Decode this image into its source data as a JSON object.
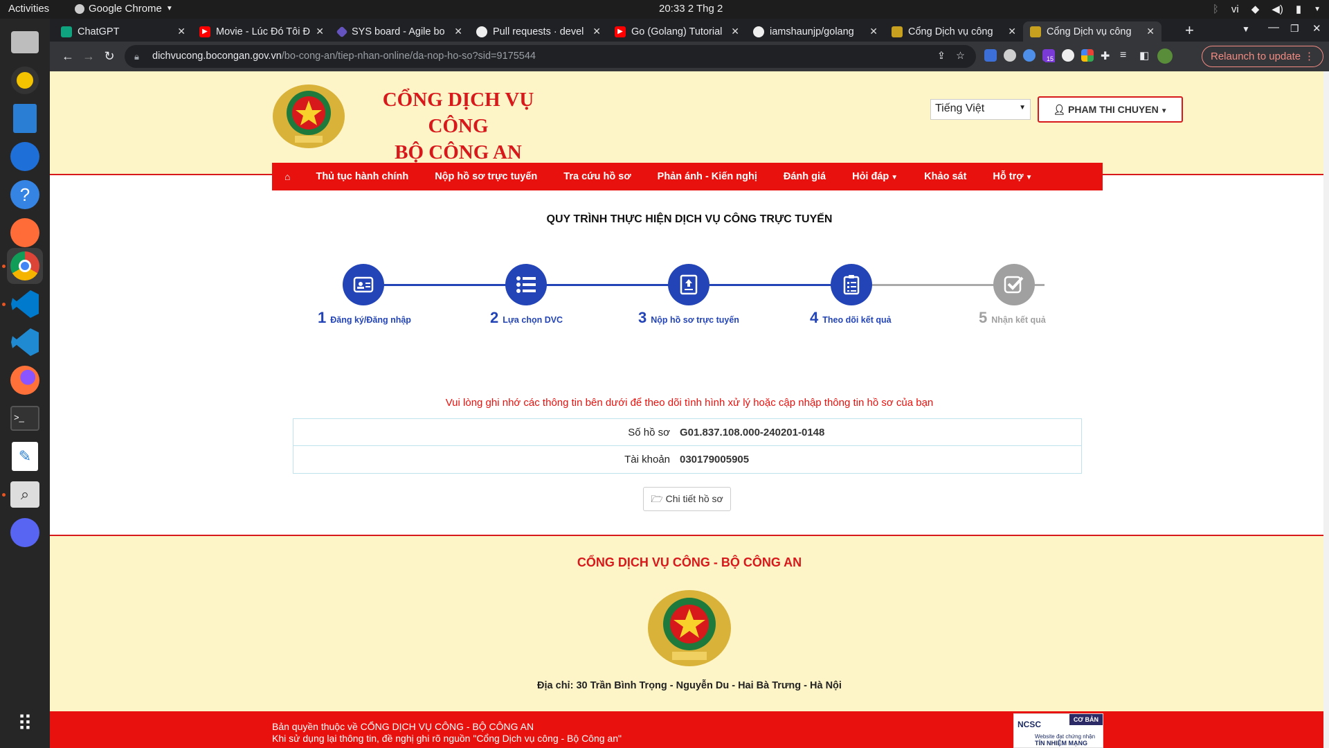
{
  "system": {
    "activities": "Activities",
    "app_name": "Google Chrome",
    "clock": "20:33  2 Thg 2",
    "language": "vi"
  },
  "dock": [
    "files-icon",
    "rhythmbox-icon",
    "writer-icon",
    "thunderbird-icon",
    "help-icon",
    "postman-icon",
    "chrome-icon",
    "vscode-icon",
    "vscode-icon",
    "firefox-icon",
    "terminal-icon",
    "text-editor-icon",
    "search-icon",
    "discord-icon",
    "apps-grid-icon"
  ],
  "tabs": [
    {
      "title": "ChatGPT",
      "color": "#10a37f"
    },
    {
      "title": "Movie - Lúc Đó Tôi Đ",
      "color": "#ff0000"
    },
    {
      "title": "SYS board - Agile bo",
      "color": "#6554c0"
    },
    {
      "title": "Pull requests · devel",
      "color": "#333333"
    },
    {
      "title": "Go (Golang) Tutorial",
      "color": "#ff0000"
    },
    {
      "title": "iamshaunjp/golang",
      "color": "#333333"
    },
    {
      "title": "Cổng Dịch vụ công",
      "color": "#c8a020"
    },
    {
      "title": "Cổng Dịch vụ công",
      "color": "#c8a020"
    }
  ],
  "url": {
    "host": "dichvucong.bocongan.gov.vn",
    "path": "/bo-cong-an/tiep-nhan-online/da-nop-ho-so?sid=9175544"
  },
  "toolbar": {
    "relaunch": "Relaunch to update",
    "ext_badge": "15"
  },
  "header": {
    "title_line1": "CỔNG DỊCH VỤ CÔNG",
    "title_line2": "BỘ CÔNG AN",
    "language_select": "Tiếng Việt",
    "user": "PHAM THI CHUYEN"
  },
  "menu": [
    "Thủ tục hành chính",
    "Nộp hồ sơ trực tuyến",
    "Tra cứu hồ sơ",
    "Phản ánh - Kiến nghị",
    "Đánh giá",
    "Hỏi đáp",
    "Khảo sát",
    "Hỗ trợ"
  ],
  "process": {
    "title": "QUY TRÌNH THỰC HIỆN DỊCH VỤ CÔNG TRỰC TUYẾN",
    "steps": [
      {
        "num": "1",
        "label": "Đăng ký/Đăng nhập"
      },
      {
        "num": "2",
        "label": "Lựa chọn DVC"
      },
      {
        "num": "3",
        "label": "Nộp hồ sơ trực tuyến"
      },
      {
        "num": "4",
        "label": "Theo dõi kết quả"
      },
      {
        "num": "5",
        "label": "Nhận kết quả"
      }
    ]
  },
  "notice": "Vui lòng ghi nhớ các thông tin bên dưới để theo dõi tình hình xử lý hoặc cập nhập thông tin hồ sơ của bạn",
  "record": {
    "so_ho_so_label": "Số hồ sơ",
    "so_ho_so": "G01.837.108.000-240201-0148",
    "tai_khoan_label": "Tài khoản",
    "tai_khoan": "030179005905"
  },
  "detail_button": "Chi tiết hồ sơ",
  "footer": {
    "title": "CỔNG DỊCH VỤ CÔNG - BỘ CÔNG AN",
    "address": "Địa chỉ: 30 Trần Bình Trọng - Nguyễn Du - Hai Bà Trưng - Hà Nội",
    "copyright1": "Bản quyền thuộc về CỔNG DỊCH VỤ CÔNG - BỘ CÔNG AN",
    "copyright2": "Khi sử dụng lại thông tin, đề nghị ghi rõ nguồn \"Cổng Dịch vụ công - Bộ Công an\"",
    "badge_ncsc": "NCSC",
    "badge_level": "CƠ BẢN",
    "badge_web": "Website đạt chứng nhận",
    "badge_trust": "TÍN NHIỆM MẠNG"
  }
}
